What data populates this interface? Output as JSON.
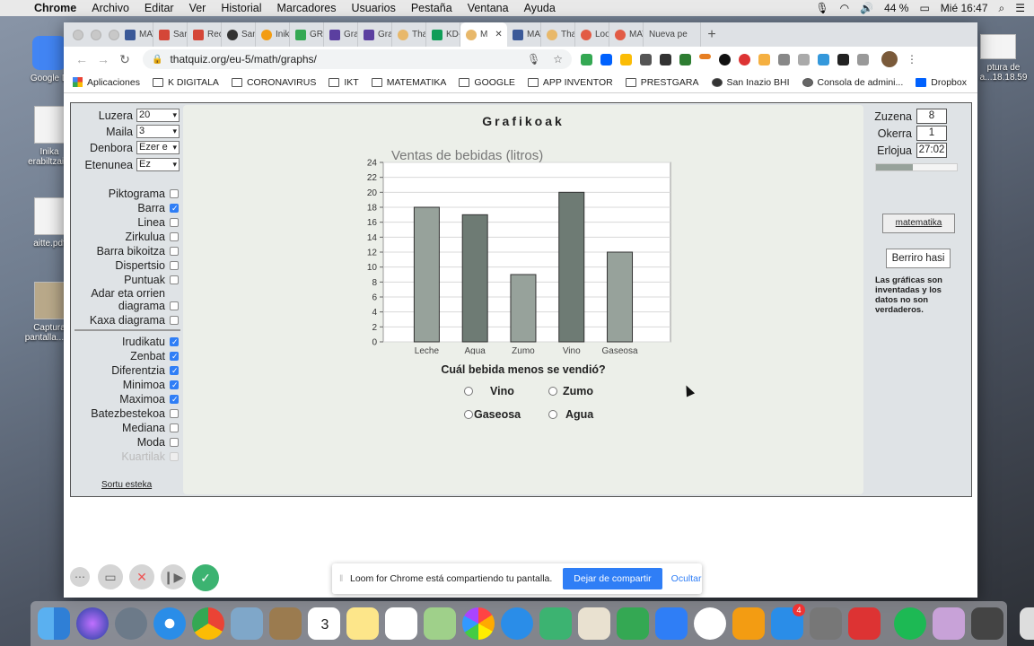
{
  "menubar": {
    "app": "Chrome",
    "items": [
      "Archivo",
      "Editar",
      "Ver",
      "Historial",
      "Marcadores",
      "Usuarios",
      "Pestaña",
      "Ventana",
      "Ayuda"
    ],
    "battery": "44 %",
    "clock": "Mié 16:47"
  },
  "desktop": {
    "icons": [
      "Google D",
      "Inika\nerabiltzaile",
      "aitte.pdf",
      "Captura\npantalla...14"
    ],
    "right_label": "ptura de\na...18.18.59"
  },
  "tabs": [
    "MAT",
    "Sarre",
    "Recib",
    "San I",
    "Inika",
    "GRA",
    "Grafi",
    "Grafi",
    "That",
    "KD-M",
    "M",
    "MAT",
    "That",
    "Loon",
    "MAT",
    "Nueva pe"
  ],
  "toolbar": {
    "url": "thatquiz.org/eu-5/math/graphs/"
  },
  "bookmarks": [
    "Aplicaciones",
    "K DIGITALA",
    "CORONAVIRUS",
    "IKT",
    "MATEMATIKA",
    "GOOGLE",
    "APP INVENTOR",
    "PRESTGARA",
    "San Inazio BHI",
    "Consola de admini...",
    "Dropbox"
  ],
  "settings": {
    "luzera_label": "Luzera",
    "luzera_value": "20",
    "maila_label": "Maila",
    "maila_value": "3",
    "denbora_label": "Denbora",
    "denbora_value": "Ezer e",
    "etenunea_label": "Etenunea",
    "etenunea_value": "Ez"
  },
  "graph_types": [
    {
      "label": "Piktograma",
      "checked": false
    },
    {
      "label": "Barra",
      "checked": true
    },
    {
      "label": "Linea",
      "checked": false
    },
    {
      "label": "Zirkulua",
      "checked": false
    },
    {
      "label": "Barra bikoitza",
      "checked": false
    },
    {
      "label": "Dispertsio",
      "checked": false
    },
    {
      "label": "Puntuak",
      "checked": false
    },
    {
      "label": "Adar eta orrien",
      "label2": "diagrama",
      "checked": false
    },
    {
      "label": "Kaxa diagrama",
      "checked": false
    }
  ],
  "question_types": [
    {
      "label": "Irudikatu",
      "checked": true
    },
    {
      "label": "Zenbat",
      "checked": true
    },
    {
      "label": "Diferentzia",
      "checked": true
    },
    {
      "label": "Minimoa",
      "checked": true
    },
    {
      "label": "Maximoa",
      "checked": true
    },
    {
      "label": "Batezbestekoa",
      "checked": false
    },
    {
      "label": "Mediana",
      "checked": false
    },
    {
      "label": "Moda",
      "checked": false
    },
    {
      "label": "Kuartilak",
      "checked": false,
      "disabled": true
    }
  ],
  "sortu_link": "Sortu esteka",
  "main": {
    "title": "Grafikoak",
    "question": "Cuál bebida menos se vendió?",
    "options": [
      "Vino",
      "Zumo",
      "Gaseosa",
      "Agua"
    ]
  },
  "chart_data": {
    "type": "bar",
    "title": "Ventas de bebidas (litros)",
    "categories": [
      "Leche",
      "Agua",
      "Zumo",
      "Vino",
      "Gaseosa"
    ],
    "values": [
      18,
      17,
      9,
      20,
      12
    ],
    "ylim": [
      0,
      24
    ],
    "yticks": [
      0,
      2,
      4,
      6,
      8,
      10,
      12,
      14,
      16,
      18,
      20,
      22,
      24
    ],
    "grid": true,
    "colors": [
      "#97a29b",
      "#6e7b74"
    ]
  },
  "stats": {
    "zuzena_label": "Zuzena",
    "zuzena_value": "8",
    "okerra_label": "Okerra",
    "okerra_value": "1",
    "erlojua_label": "Erlojua",
    "erlojua_value": "27:02",
    "progress": 0.45
  },
  "buttons": {
    "matematika": "matematika",
    "berriro": "Berriro hasi"
  },
  "note": "Las gráficas son inventadas y los datos no son verdaderos.",
  "loom": {
    "message": "Loom for Chrome está compartiendo tu pantalla.",
    "stop": "Dejar de compartir",
    "hide": "Ocultar"
  },
  "dock": {
    "calendar_day": "3",
    "appstore_badge": "4"
  }
}
